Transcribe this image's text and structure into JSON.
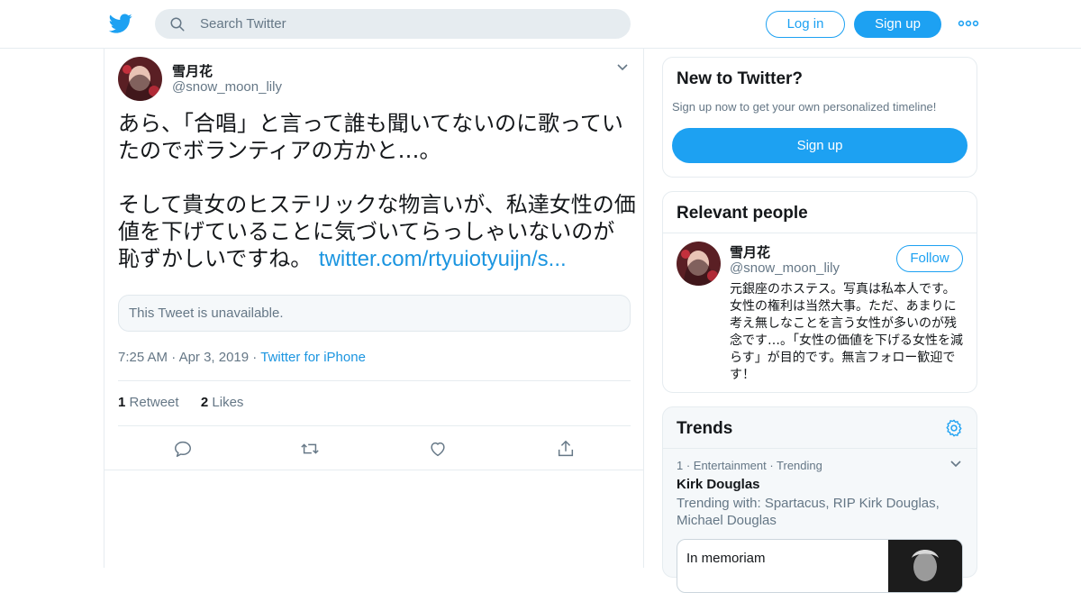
{
  "topbar": {
    "search_placeholder": "Search Twitter",
    "login_label": "Log in",
    "signup_label": "Sign up",
    "brand_color": "#1da1f2"
  },
  "tweet": {
    "display_name": "雪月花",
    "handle": "@snow_moon_lily",
    "text_para1": "あら、「合唱」と言って誰も聞いてないのに歌っていたのでボランティアの方かと…。",
    "text_para2": "そして貴女のヒステリックな物言いが、私達女性の価値を下げていることに気づいてらっしゃいないのが恥ずかしいですね。",
    "link": "twitter.com/rtyuiotyuijn/s...",
    "quote_unavailable": "This Tweet is unavailable.",
    "time": "7:25 AM",
    "date": "Apr 3, 2019",
    "source": "Twitter for iPhone",
    "retweet_count": "1",
    "retweet_label": "Retweet",
    "like_count": "2",
    "like_label": "Likes"
  },
  "sidebar": {
    "new_to_twitter": {
      "title": "New to Twitter?",
      "subtitle": "Sign up now to get your own personalized timeline!",
      "button": "Sign up"
    },
    "relevant_people": {
      "title": "Relevant people",
      "name": "雪月花",
      "handle": "@snow_moon_lily",
      "follow_label": "Follow",
      "bio": "元銀座のホステス。写真は私本人です。 女性の権利は当然大事。ただ、あまりに考え無しなことを言う女性が多いのが残念です…。「女性の価値を下げる女性を減らす」が目的です。無言フォロー歓迎です！"
    },
    "trends": {
      "title": "Trends",
      "item1_meta": "1 · Entertainment · Trending",
      "item1_name": "Kirk Douglas",
      "item1_with": "Trending with: Spartacus, RIP Kirk Douglas, Michael Douglas",
      "card_label": "In memoriam"
    }
  }
}
